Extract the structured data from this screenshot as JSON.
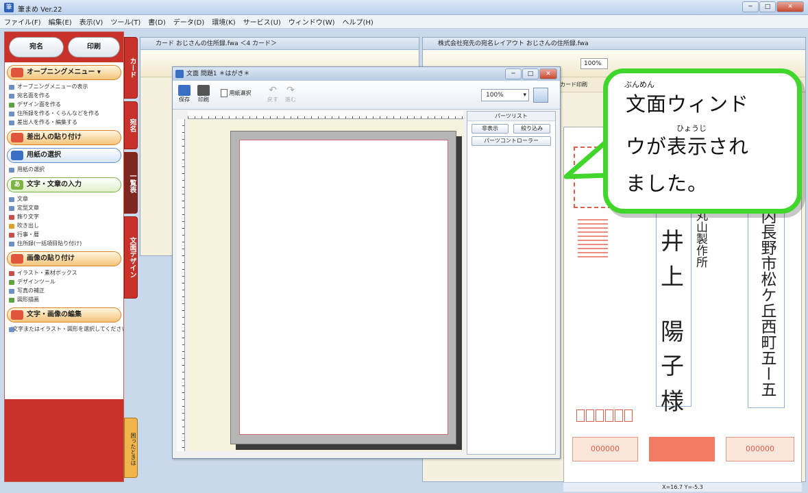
{
  "window": {
    "title": "筆まめ Ver.22"
  },
  "menu": [
    "ファイル(F)",
    "編集(E)",
    "表示(V)",
    "ツール(T)",
    "書(D)",
    "データ(D)",
    "環境(K)",
    "サービス(U)",
    "ウィンドウ(W)",
    "ヘルプ(H)"
  ],
  "left_panel": {
    "top_buttons": [
      "宛名",
      "印刷"
    ],
    "sections": [
      {
        "title": "オープニングメニュー",
        "items": [
          "オープニングメニューの表示",
          "宛名面を作る",
          "デザイン面を作る",
          "住所録を作る・くらんなどを作る",
          "差出人を作る・編集する"
        ]
      },
      {
        "title": "差出人の貼り付け",
        "items": []
      },
      {
        "title": "用紙の選択",
        "items": [
          "用紙の選択"
        ]
      },
      {
        "title": "文字・文章の入力",
        "items": [
          "文章",
          "定型文章",
          "飾り文字",
          "吹き出し",
          "行事・暦",
          "住所録(一括項目貼り付け)"
        ]
      },
      {
        "title": "画像の貼り付け",
        "items": [
          "イラスト・素材ボックス",
          "デザインツール",
          "写真の補正",
          "図形描画"
        ]
      },
      {
        "title": "文字・画像の編集",
        "items": [
          "(文字またはイラスト・図形を選択してください)"
        ]
      }
    ],
    "vertical_tabs": [
      "カード",
      "宛名",
      "一覧表",
      "文面デザイン"
    ],
    "help_tab": "困ったときは"
  },
  "back_windows": {
    "card_window_title": "カード おじさんの住所録.fwa ＜4 カード＞",
    "layout_window_title": "株式会社宛先の宛名レイアウト おじさんの住所録.fwa",
    "layout_zoom": "100%",
    "layout_tab": "カード印刷"
  },
  "postcard": {
    "address_column": "内長野市松ケ丘西町五ー五",
    "company_column": "丸山製作所",
    "name_chars": [
      "井",
      "上",
      "陽",
      "子",
      "様"
    ],
    "stamp_labels": [
      "000000",
      "000000"
    ]
  },
  "dialog": {
    "title": "文面 問題1 ＊はがき＊",
    "toolbar": [
      {
        "label": "保存"
      },
      {
        "label": "印刷"
      },
      {
        "label": "用紙選択"
      },
      {
        "label": "戻す"
      },
      {
        "label": "進む"
      }
    ],
    "zoom": "100%",
    "parts_panel": {
      "title": "パーツリスト",
      "buttons": [
        "非表示",
        "絞り込み"
      ],
      "controller_button": "パーツコントローラー"
    }
  },
  "callout": {
    "lines": [
      "文面ウィンド",
      "ウが表示され",
      "ました。"
    ],
    "ruby": {
      "bunmen": "ぶんめん",
      "hyouji": "ひょうじ"
    }
  },
  "status_bar": {
    "coords": "X=16.7 Y=-5.3"
  },
  "colors": {
    "accent_red": "#c9312b",
    "callout_border": "#41d62c"
  }
}
